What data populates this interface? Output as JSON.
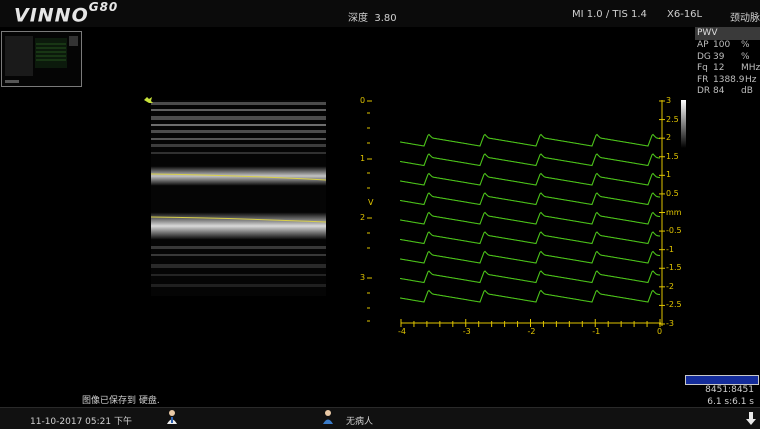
{
  "header": {
    "logo_text": "VINNO",
    "logo_model": "G80",
    "depth_label": "深度",
    "depth_value": "3.80",
    "mi_tis": "MI 1.0 / TIS 1.4",
    "probe": "X6-16L",
    "preset": "颈动脉"
  },
  "params": {
    "mode": "PWV",
    "rows": [
      {
        "k": "AP",
        "v": "100",
        "u": "%"
      },
      {
        "k": "DG",
        "v": "39",
        "u": "%"
      },
      {
        "k": "Fq",
        "v": "12",
        "u": "MHz"
      },
      {
        "k": "FR",
        "v": "1388.9",
        "u": "Hz"
      },
      {
        "k": "DR",
        "v": "84",
        "u": "dB"
      }
    ]
  },
  "left_scale": {
    "labels": [
      "0",
      "1",
      "2",
      "3"
    ],
    "marker": "V"
  },
  "right_scale": {
    "labels": [
      "3",
      "2.5",
      "2",
      "1.5",
      "1",
      "0.5",
      "mm",
      "-0.5",
      "-1",
      "-1.5",
      "-2",
      "-2.5",
      "-3"
    ]
  },
  "time_axis": {
    "labels": [
      "-4",
      "-3",
      "-2",
      "-1",
      "0"
    ]
  },
  "status_message": "图像已保存到 硬盘.",
  "counter": {
    "frames": "8451:8451",
    "time": "6.1 s:6.1 s"
  },
  "footer": {
    "datetime": "11-10-2017 05:21 下午",
    "patient": "无病人"
  },
  "colors": {
    "trace": "#4cc21a",
    "scale": "#e0c400",
    "counter_bar": "#142c9a"
  }
}
